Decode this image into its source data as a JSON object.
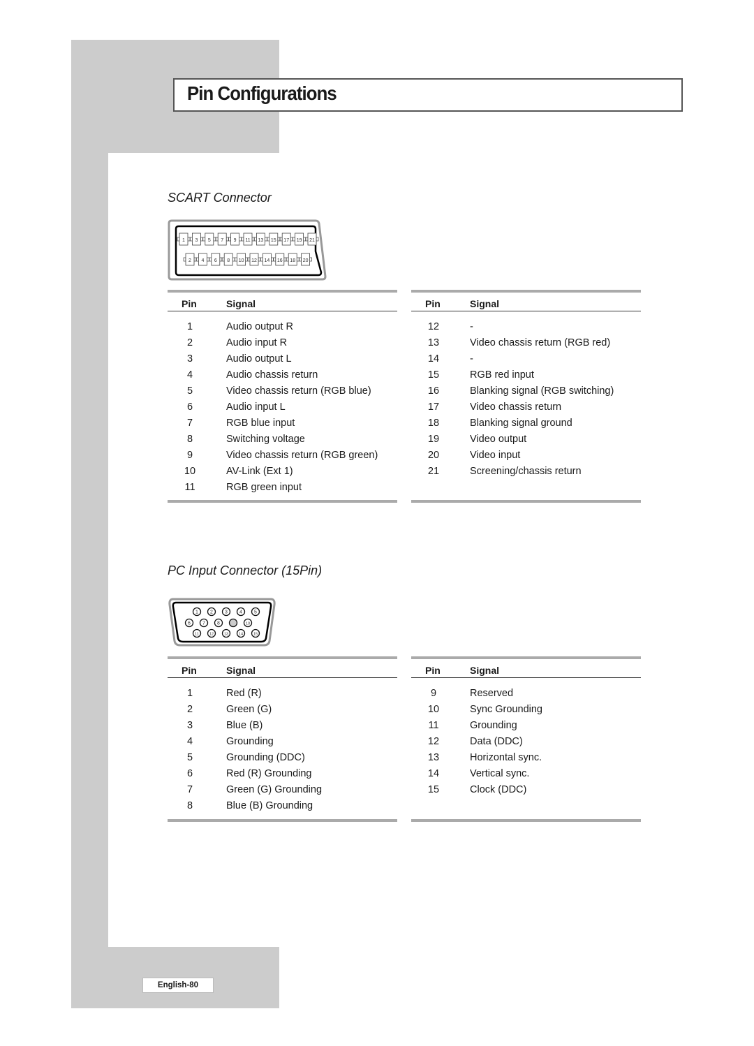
{
  "page": {
    "title": "Pin Configurations",
    "page_number": "English-80"
  },
  "scart": {
    "section_title": "SCART Connector",
    "connector_icon": "scart-connector-diagram",
    "top_row_pins": [
      "1",
      "3",
      "5",
      "7",
      "9",
      "11",
      "13",
      "15",
      "17",
      "19",
      "21"
    ],
    "bottom_row_pins": [
      "2",
      "4",
      "6",
      "8",
      "10",
      "12",
      "14",
      "16",
      "18",
      "20"
    ],
    "headers": {
      "pin": "Pin",
      "signal": "Signal"
    },
    "left": [
      {
        "pin": "1",
        "signal": "Audio output R"
      },
      {
        "pin": "2",
        "signal": "Audio input R"
      },
      {
        "pin": "3",
        "signal": "Audio output L"
      },
      {
        "pin": "4",
        "signal": "Audio chassis return"
      },
      {
        "pin": "5",
        "signal": "Video chassis return (RGB blue)"
      },
      {
        "pin": "6",
        "signal": "Audio input L"
      },
      {
        "pin": "7",
        "signal": "RGB blue input"
      },
      {
        "pin": "8",
        "signal": "Switching voltage"
      },
      {
        "pin": "9",
        "signal": "Video chassis return (RGB green)"
      },
      {
        "pin": "10",
        "signal": "AV-Link (Ext 1)"
      },
      {
        "pin": "11",
        "signal": "RGB green input"
      }
    ],
    "right": [
      {
        "pin": "12",
        "signal": " -"
      },
      {
        "pin": "13",
        "signal": "Video chassis return (RGB red)"
      },
      {
        "pin": "14",
        "signal": " -"
      },
      {
        "pin": "15",
        "signal": "RGB red input"
      },
      {
        "pin": "16",
        "signal": "Blanking signal (RGB switching)"
      },
      {
        "pin": "17",
        "signal": "Video chassis return"
      },
      {
        "pin": "18",
        "signal": "Blanking signal ground"
      },
      {
        "pin": "19",
        "signal": "Video output"
      },
      {
        "pin": "20",
        "signal": "Video input"
      },
      {
        "pin": "21",
        "signal": "Screening/chassis return"
      }
    ]
  },
  "pc": {
    "section_title": "PC Input Connector (15Pin)",
    "connector_icon": "vga-connector-diagram",
    "row1_pins": [
      "1",
      "2",
      "3",
      "4",
      "5"
    ],
    "row2_pins": [
      "6",
      "7",
      "8",
      "",
      "10"
    ],
    "row3_pins": [
      "11",
      "12",
      "13",
      "14",
      "15"
    ],
    "headers": {
      "pin": "Pin",
      "signal": "Signal"
    },
    "left": [
      {
        "pin": "1",
        "signal": "Red (R)"
      },
      {
        "pin": "2",
        "signal": "Green (G)"
      },
      {
        "pin": "3",
        "signal": "Blue (B)"
      },
      {
        "pin": "4",
        "signal": "Grounding"
      },
      {
        "pin": "5",
        "signal": "Grounding (DDC)"
      },
      {
        "pin": "6",
        "signal": "Red (R) Grounding"
      },
      {
        "pin": "7",
        "signal": "Green (G) Grounding"
      },
      {
        "pin": "8",
        "signal": "Blue (B) Grounding"
      }
    ],
    "right": [
      {
        "pin": "9",
        "signal": "Reserved"
      },
      {
        "pin": "10",
        "signal": "Sync Grounding"
      },
      {
        "pin": "11",
        "signal": "Grounding"
      },
      {
        "pin": "12",
        "signal": "Data (DDC)"
      },
      {
        "pin": "13",
        "signal": "Horizontal sync."
      },
      {
        "pin": "14",
        "signal": "Vertical sync."
      },
      {
        "pin": "15",
        "signal": "Clock (DDC)"
      }
    ]
  },
  "colors": {
    "frame_gray": "#cccccc",
    "rule_gray": "#aaaaaa",
    "text": "#1a1a1a"
  }
}
